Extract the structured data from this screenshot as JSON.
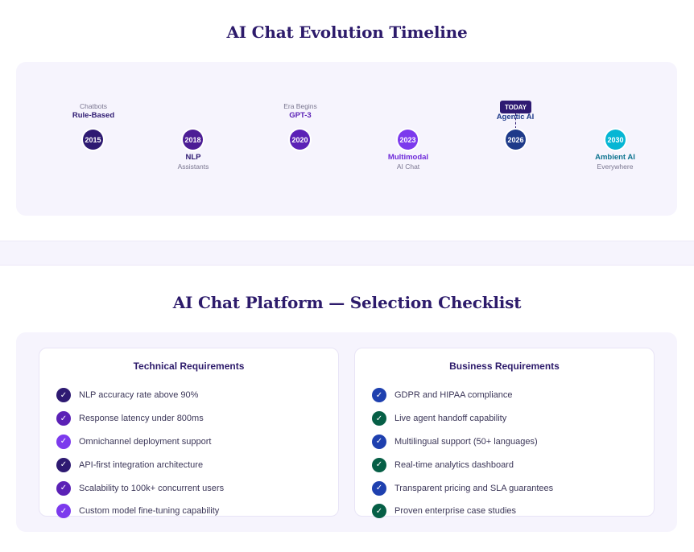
{
  "timeline": {
    "title": "AI Chat Evolution Timeline",
    "today_label": "TODAY",
    "milestones": [
      {
        "year": "2015",
        "label": "Rule-Based",
        "sub": "Chatbots",
        "color": "#2e1a72",
        "label_color": "#2e1a72"
      },
      {
        "year": "2018",
        "label": "NLP",
        "sub": "Assistants",
        "color": "#4c1d95",
        "label_color": "#2e1a72"
      },
      {
        "year": "2020",
        "label": "GPT-3",
        "sub": "Era Begins",
        "color": "#5b21b6",
        "label_color": "#5b21b6"
      },
      {
        "year": "2023",
        "label": "Multimodal",
        "sub": "AI Chat",
        "color": "#7c3aed",
        "label_color": "#6d28d9"
      },
      {
        "year": "2026",
        "label": "Agentic AI",
        "sub": "",
        "color": "#1e3a8a",
        "label_color": "#1e3a8a"
      },
      {
        "year": "2030",
        "label": "Ambient AI",
        "sub": "Everywhere",
        "color": "#06b6d4",
        "label_color": "#0e7490"
      }
    ]
  },
  "checklist": {
    "title": "AI Chat Platform — Selection Checklist",
    "check_glyph": "✓",
    "technical": {
      "title": "Technical Requirements",
      "items": [
        {
          "text": "NLP accuracy rate above 90%",
          "color": "#2e1a72"
        },
        {
          "text": "Response latency under 800ms",
          "color": "#5b21b6"
        },
        {
          "text": "Omnichannel deployment support",
          "color": "#7c3aed"
        },
        {
          "text": "API-first integration architecture",
          "color": "#2e1a72"
        },
        {
          "text": "Scalability to 100k+ concurrent users",
          "color": "#5b21b6"
        },
        {
          "text": "Custom model fine-tuning capability",
          "color": "#7c3aed"
        }
      ]
    },
    "business": {
      "title": "Business Requirements",
      "items": [
        {
          "text": "GDPR and HIPAA compliance",
          "color": "#1e40af"
        },
        {
          "text": "Live agent handoff capability",
          "color": "#065f46"
        },
        {
          "text": "Multilingual support (50+ languages)",
          "color": "#1e40af"
        },
        {
          "text": "Real-time analytics dashboard",
          "color": "#065f46"
        },
        {
          "text": "Transparent pricing and SLA guarantees",
          "color": "#1e40af"
        },
        {
          "text": "Proven enterprise case studies",
          "color": "#065f46"
        }
      ]
    }
  }
}
